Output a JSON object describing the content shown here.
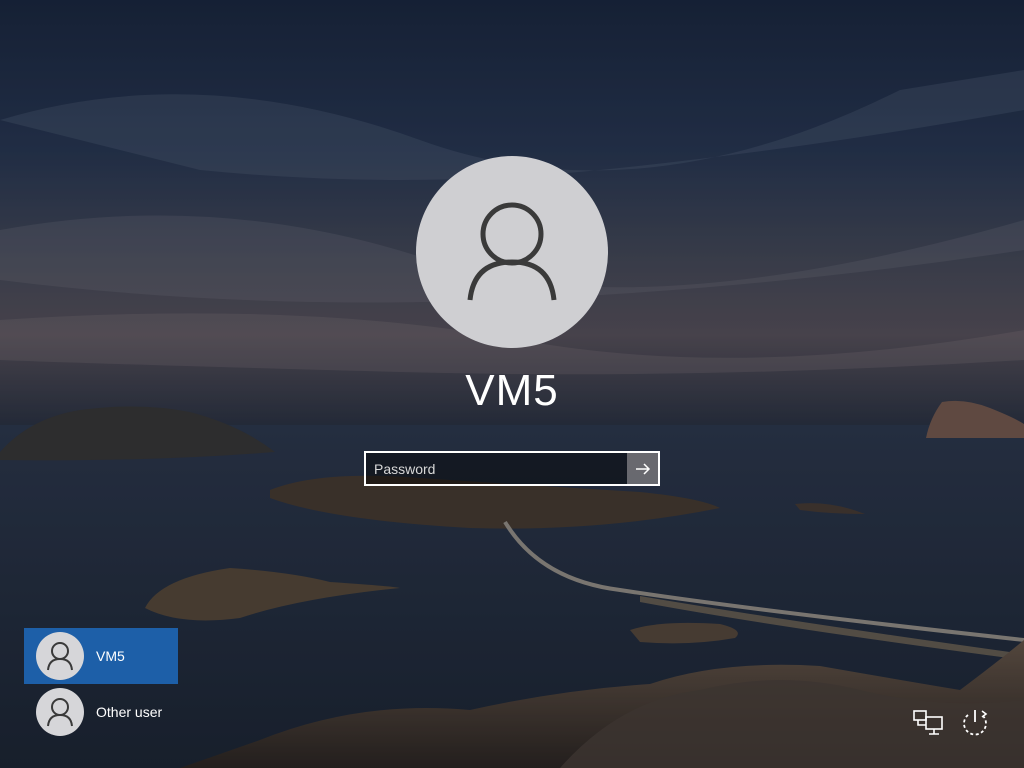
{
  "lock_screen": {
    "username": "VM5",
    "avatar_icon": "user-icon"
  },
  "password": {
    "placeholder": "Password",
    "value": "",
    "submit_icon": "arrow-right-icon"
  },
  "user_list": [
    {
      "name": "VM5",
      "selected": true,
      "icon": "user-icon"
    },
    {
      "name": "Other user",
      "selected": false,
      "icon": "user-icon"
    }
  ],
  "corner_icons": {
    "network": "network-icon",
    "power": "power-icon"
  },
  "colors": {
    "selected_tile": "#1d5fa8",
    "avatar_bg": "#cfcfd2",
    "text": "#ffffff"
  }
}
